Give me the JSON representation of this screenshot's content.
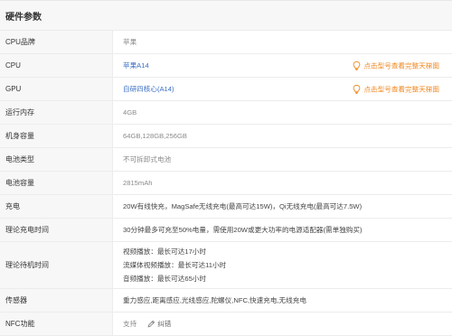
{
  "section": {
    "title": "硬件参数"
  },
  "rows": [
    {
      "label": "CPU品牌",
      "value": "苹果"
    },
    {
      "label": "CPU",
      "value": "苹果A14",
      "action": "点击型号查看完整天梯图"
    },
    {
      "label": "GPU",
      "value": "自研四核心(A14)",
      "action": "点击型号查看完整天梯图"
    },
    {
      "label": "运行内存",
      "value": "4GB"
    },
    {
      "label": "机身容量",
      "value": "64GB,128GB,256GB"
    },
    {
      "label": "电池类型",
      "value": "不可拆卸式电池"
    },
    {
      "label": "电池容量",
      "value": "2815mAh"
    },
    {
      "label": "充电",
      "value": "20W有线快充，MagSafe无线充电(最高可达15W)，Qi无线充电(最高可达7.5W)"
    },
    {
      "label": "理论充电时间",
      "value": "30分钟最多可充至50%电量，需使用20W或更大功率的电源适配器(需单独购买)"
    },
    {
      "label": "理论待机时间",
      "lines": [
        "视频播放：最长可达17小时",
        "流媒体视频播放：最长可达11小时",
        "音频播放：最长可达65小时"
      ]
    },
    {
      "label": "传感器",
      "value": "重力感应,距离感应,光线感应,陀螺仪,NFC,快速充电,无线充电"
    },
    {
      "label": "NFC功能",
      "value": "支持",
      "edit": "纠错"
    }
  ],
  "colors": {
    "link": "#3a6fc4",
    "action": "#f08a24",
    "label_bg": "#f7f7f7"
  },
  "icons": {
    "action": "lightbulb-icon",
    "edit": "pencil-icon"
  }
}
